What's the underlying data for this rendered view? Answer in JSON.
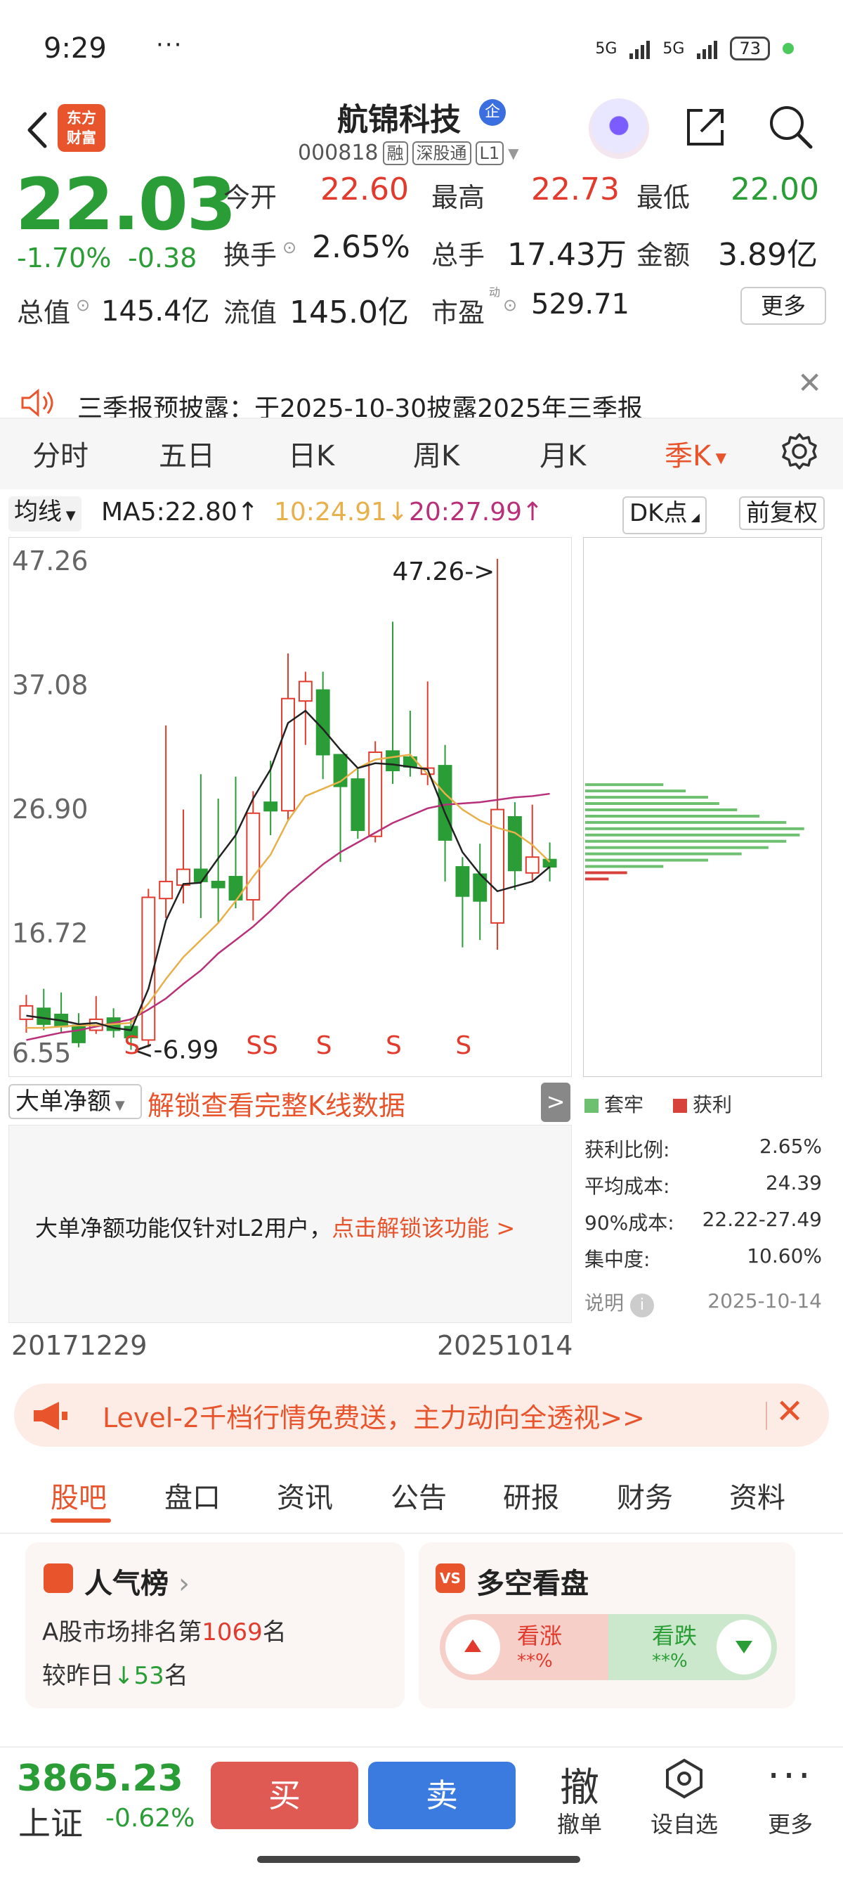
{
  "status_bar": {
    "time": "9:29",
    "dots": "···",
    "net1": "5G",
    "net2": "5G",
    "battery": "73"
  },
  "header": {
    "brand": "东方\n财富",
    "stock_name": "航锦科技",
    "qi_badge": "企",
    "stock_code": "000818",
    "tags": [
      "融",
      "深股通",
      "L1"
    ]
  },
  "quote": {
    "price": "22.03",
    "change_pct": "-1.70%",
    "change": "-0.38",
    "open_label": "今开",
    "open": "22.60",
    "high_label": "最高",
    "high": "22.73",
    "low_label": "最低",
    "low": "22.00",
    "turnover_label": "换手",
    "turnover": "2.65%",
    "volume_label": "总手",
    "volume": "17.43万",
    "amount_label": "金额",
    "amount": "3.89亿",
    "mktcap_label": "总值",
    "mktcap": "145.4亿",
    "float_label": "流值",
    "float": "145.0亿",
    "pe_label": "市盈",
    "pe_sup": "动",
    "pe": "529.71",
    "more": "更多"
  },
  "announcement": {
    "text": "三季报预披露：于2025-10-30披露2025年三季报"
  },
  "period_tabs": [
    "分时",
    "五日",
    "日K",
    "周K",
    "月K",
    "季K"
  ],
  "ma_row": {
    "selector": "均线",
    "ma5": "MA5:22.80",
    "ma5_arrow": "↑",
    "ma10": "10:24.91",
    "ma10_arrow": "↓",
    "ma20": "20:27.99",
    "ma20_arrow": "↑",
    "dk": "DK点",
    "adjust": "前复权",
    "ma5_color": "#222222",
    "ma10_color": "#e8b04a",
    "ma20_color": "#b8307a"
  },
  "chart_data": {
    "type": "candlestick",
    "y_ticks": [
      "47.26",
      "37.08",
      "26.90",
      "16.72",
      "6.55"
    ],
    "ylim": [
      6.55,
      47.26
    ],
    "max_label": "47.26->",
    "min_label": "<-6.99",
    "signals": [
      "S",
      "SS",
      "S",
      "S",
      "S"
    ],
    "x_start": "20171229",
    "x_end": "20251014",
    "up_color": "#e23b2e",
    "down_color": "#2a9d36",
    "candles": [
      {
        "o": 9.5,
        "c": 10.6,
        "h": 11.5,
        "l": 8.4
      },
      {
        "o": 10.4,
        "c": 9.1,
        "h": 12.0,
        "l": 8.6
      },
      {
        "o": 9.9,
        "c": 8.9,
        "h": 11.7,
        "l": 8.4
      },
      {
        "o": 9.0,
        "c": 7.6,
        "h": 10.0,
        "l": 7.2
      },
      {
        "o": 8.6,
        "c": 9.5,
        "h": 11.4,
        "l": 8.3
      },
      {
        "o": 9.6,
        "c": 8.6,
        "h": 10.4,
        "l": 8.0
      },
      {
        "o": 8.9,
        "c": 8.0,
        "h": 9.6,
        "l": 6.99
      },
      {
        "o": 7.8,
        "c": 19.5,
        "h": 20.2,
        "l": 7.2
      },
      {
        "o": 19.4,
        "c": 20.8,
        "h": 33.6,
        "l": 17.8
      },
      {
        "o": 20.5,
        "c": 21.8,
        "h": 26.7,
        "l": 19.0
      },
      {
        "o": 21.8,
        "c": 20.8,
        "h": 29.6,
        "l": 17.8
      },
      {
        "o": 20.8,
        "c": 20.3,
        "h": 27.6,
        "l": 17.4
      },
      {
        "o": 21.2,
        "c": 19.3,
        "h": 29.4,
        "l": 18.6
      },
      {
        "o": 19.3,
        "c": 26.4,
        "h": 28.2,
        "l": 17.6
      },
      {
        "o": 27.3,
        "c": 26.6,
        "h": 30.7,
        "l": 24.6
      },
      {
        "o": 26.6,
        "c": 35.8,
        "h": 39.5,
        "l": 25.8
      },
      {
        "o": 35.6,
        "c": 37.2,
        "h": 38.0,
        "l": 32.0
      },
      {
        "o": 36.5,
        "c": 31.2,
        "h": 38.0,
        "l": 29.2
      },
      {
        "o": 31.2,
        "c": 28.6,
        "h": 30.8,
        "l": 22.4
      },
      {
        "o": 29.2,
        "c": 25.0,
        "h": 30.0,
        "l": 24.3
      },
      {
        "o": 24.5,
        "c": 31.4,
        "h": 32.3,
        "l": 24.0
      },
      {
        "o": 31.5,
        "c": 29.9,
        "h": 42.1,
        "l": 28.8
      },
      {
        "o": 31.0,
        "c": 30.2,
        "h": 34.8,
        "l": 29.4
      },
      {
        "o": 29.6,
        "c": 30.1,
        "h": 37.2,
        "l": 28.7
      },
      {
        "o": 30.3,
        "c": 24.2,
        "h": 32.0,
        "l": 20.8
      },
      {
        "o": 22.0,
        "c": 19.6,
        "h": 22.8,
        "l": 15.4
      },
      {
        "o": 21.4,
        "c": 19.2,
        "h": 23.9,
        "l": 16.0
      },
      {
        "o": 17.4,
        "c": 26.7,
        "h": 47.26,
        "l": 15.2
      },
      {
        "o": 26.1,
        "c": 21.7,
        "h": 27.3,
        "l": 20.1
      },
      {
        "o": 21.5,
        "c": 22.8,
        "h": 27.1,
        "l": 20.9
      },
      {
        "o": 22.6,
        "c": 22.0,
        "h": 24.0,
        "l": 20.8
      }
    ],
    "ma5": [
      9.8,
      9.6,
      9.4,
      9.1,
      9.2,
      8.8,
      8.6,
      12.0,
      17.6,
      20.6,
      20.7,
      22.7,
      24.6,
      27.6,
      30.0,
      33.8,
      34.8,
      33.3,
      31.6,
      30.1,
      30.5,
      30.4,
      30.2,
      30.0,
      26.4,
      23.2,
      21.4,
      20.0,
      20.4,
      20.8,
      22.0
    ],
    "ma10": [
      8.8,
      8.8,
      8.9,
      9.0,
      9.0,
      9.1,
      9.2,
      10.8,
      12.8,
      14.6,
      16.0,
      17.4,
      19.2,
      21.2,
      23.0,
      25.8,
      27.8,
      28.4,
      29.0,
      30.1,
      30.8,
      31.0,
      31.2,
      29.6,
      28.0,
      26.7,
      25.8,
      25.2,
      24.8,
      23.8,
      22.4
    ],
    "ma20": [
      7.8,
      8.1,
      8.4,
      8.6,
      8.9,
      9.2,
      9.5,
      10.3,
      11.2,
      12.4,
      13.5,
      14.9,
      16.0,
      17.1,
      18.4,
      19.8,
      21.0,
      22.2,
      23.2,
      24.0,
      24.8,
      25.6,
      26.2,
      26.8,
      27.1,
      27.2,
      27.3,
      27.5,
      27.7,
      27.8,
      28.0
    ]
  },
  "chip_chart": {
    "legend_trap": "套牢",
    "legend_profit": "获利",
    "trap_color": "#6cc070",
    "profit_color": "#d8423c",
    "bars_green": [
      0.35,
      0.45,
      0.55,
      0.6,
      0.68,
      0.78,
      0.9,
      0.98,
      0.96,
      0.9,
      0.82,
      0.7,
      0.55,
      0.35
    ],
    "bars_red": [
      0.5,
      0.28
    ],
    "profit_ratio_label": "获利比例:",
    "profit_ratio": "2.65%",
    "avg_cost_label": "平均成本:",
    "avg_cost": "24.39",
    "cost90_label": "90%成本:",
    "cost90": "22.22-27.49",
    "concentration_label": "集中度:",
    "concentration": "10.60%",
    "note_label": "说明",
    "note_date": "2025-10-14"
  },
  "big_order": {
    "selector": "大单净额",
    "unlock_link": "解锁查看完整K线数据",
    "expand": ">",
    "msg": "大单净额功能仅针对L2用户，",
    "msg_link": "点击解锁该功能 >"
  },
  "level2": {
    "text": "Level-2千档行情免费送，主力动向全透视>>"
  },
  "bottom_tabs": [
    "股吧",
    "盘口",
    "资讯",
    "公告",
    "研报",
    "财务",
    "资料"
  ],
  "hot_card": {
    "title": "人气榜",
    "chevron": "›",
    "line1_pre": "A股市场排名第",
    "rank": "1069",
    "line1_post": "名",
    "line2_pre": "较昨日",
    "line2_arrow": "↓",
    "delta": "53",
    "line2_post": "名"
  },
  "vs_card": {
    "badge": "VS",
    "title": "多空看盘",
    "up_label": "看涨",
    "up_value": "**%",
    "down_label": "看跌",
    "down_value": "**%"
  },
  "bottom_bar": {
    "index_value": "3865.23",
    "index_name": "上证",
    "index_change": "-0.62%",
    "buy": "买",
    "sell": "卖",
    "cancel_icon": "撤",
    "cancel": "撤单",
    "watch": "设自选",
    "more": "更多"
  }
}
